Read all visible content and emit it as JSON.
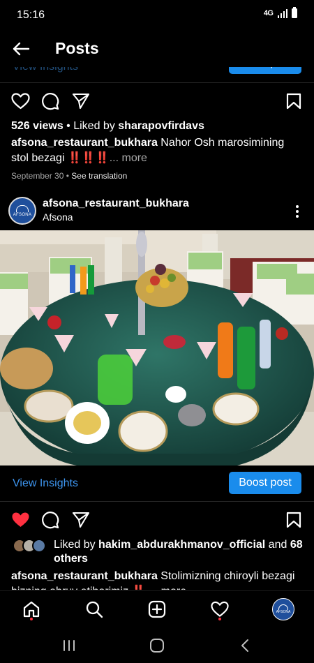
{
  "status_bar": {
    "time": "15:16",
    "network": "4G",
    "battery_icon": "battery-icon",
    "signal_icon": "signal-icon"
  },
  "header": {
    "title": "Posts",
    "back_icon": "back-arrow-icon"
  },
  "previous_post": {
    "insights_label": "View Insights",
    "boost_label": "Boost post"
  },
  "post1": {
    "views": "526 views",
    "liked_by_prefix": " • Liked by ",
    "liked_by_user": "sharapovfirdavs",
    "username": "afsona_restaurant_bukhara",
    "caption": " Nahor Osh marosimining stol bezagi ",
    "emoji": "‼️‼️‼️",
    "more": "... more",
    "date": "September 30",
    "separator": " • ",
    "translation": "See translation"
  },
  "post2": {
    "username": "afsona_restaurant_bukhara",
    "location": "Afsona",
    "avatar_text": "AFSONA",
    "image_alt": "Decorated round banquet table with green tablecloth, fruit basket centerpiece, plates, glasses and drinks",
    "insights_label": "View Insights",
    "boost_label": "Boost post",
    "liked_by_prefix": "Liked by ",
    "liked_by_user": "hakim_abdurakhmanov_official",
    "liked_by_and": " and ",
    "liked_by_others": "68 others",
    "caption_user": "afsona_restaurant_bukhara",
    "caption": " Stolimizning chiroyli bezagi",
    "caption_line2": "bizning obruy etiborimiz ‼️ ... more"
  },
  "colors": {
    "accent": "#1a8cec",
    "link": "#3d95ef",
    "like": "#ff3040",
    "background": "#000000",
    "muted": "#a8a8a8"
  },
  "nav": {
    "home": "home-icon",
    "search": "search-icon",
    "create": "create-icon",
    "activity": "heart-icon",
    "profile": "profile-avatar"
  }
}
